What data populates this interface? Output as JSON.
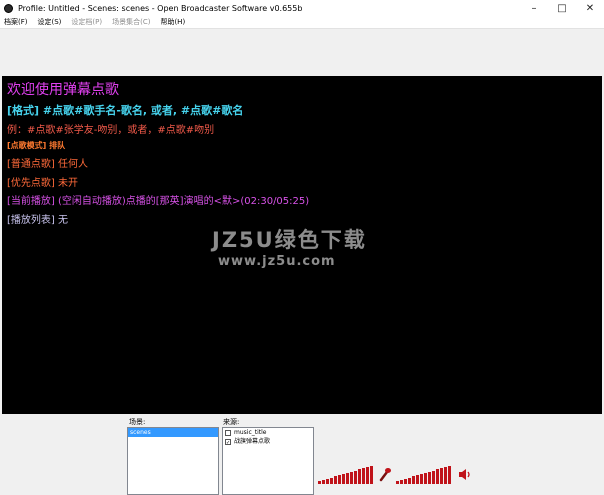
{
  "window": {
    "title": "Profile: Untitled - Scenes: scenes - Open Broadcaster Software v0.655b",
    "minimize_glyph": "–",
    "maximize_glyph": "□",
    "close_glyph": "✕"
  },
  "menu": [
    {
      "label": "档案(F)",
      "disabled": false
    },
    {
      "label": "设定(S)",
      "disabled": false
    },
    {
      "label": "设定档(P)",
      "disabled": true
    },
    {
      "label": "场景集合(C)",
      "disabled": true
    },
    {
      "label": "帮助(H)",
      "disabled": false
    }
  ],
  "preview": {
    "lines": [
      {
        "text": "欢迎使用弹幕点歌",
        "color": "#e040ef",
        "size": 14,
        "bold": false
      },
      {
        "text": "[格式] #点歌#歌手名-歌名, 或者, #点歌#歌名",
        "color": "#46d2ec",
        "size": 11,
        "bold": true
      },
      {
        "text": "例：#点歌#张学友-吻别，或者，#点歌#吻别",
        "color": "#f25a4a",
        "size": 10,
        "bold": false
      },
      {
        "text": "[点歌模式] 排队",
        "color": "#ff7a30",
        "size": 8,
        "bold": true
      },
      {
        "text": "[普通点歌] 任何人",
        "color": "#ff6a3a",
        "size": 10,
        "bold": false
      },
      {
        "text": "[优先点歌] 未开",
        "color": "#ff6a3a",
        "size": 10,
        "bold": false
      },
      {
        "text": "[当前播放] (空闲自动播放)点播的[那英]演唱的<默>(02:30/05:25)",
        "color": "#d852e8",
        "size": 10,
        "bold": false
      },
      {
        "text": "[播放列表] 无",
        "color": "#c9c4ee",
        "size": 10,
        "bold": false
      }
    ],
    "watermark": {
      "main": "JZ5U绿色下载",
      "url": "www.jz5u.com"
    }
  },
  "scenes": {
    "label": "场景:",
    "items": [
      "scenes"
    ],
    "selected_index": 0
  },
  "sources": {
    "label": "来源:",
    "items": [
      {
        "name": "music_title",
        "checked": false
      },
      {
        "name": "战旗弹幕点歌",
        "checked": true
      }
    ]
  },
  "audio": {
    "mic_icon": "microphone-icon",
    "speaker_icon": "speaker-icon",
    "meter_color": "#c0131a"
  }
}
